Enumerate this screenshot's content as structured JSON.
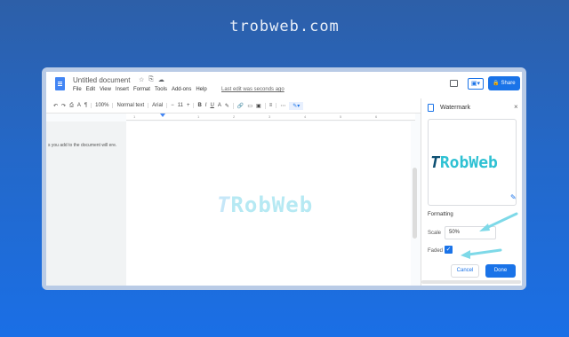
{
  "site": {
    "title": "trobweb.com"
  },
  "header": {
    "doc_title": "Untitled document",
    "title_icons": [
      "☆",
      "⎘",
      "☁"
    ],
    "menu": [
      "File",
      "Edit",
      "View",
      "Insert",
      "Format",
      "Tools",
      "Add-ons",
      "Help"
    ],
    "last_edit": "Last edit was seconds ago",
    "present_icon": "▣▾",
    "share_label": "🔒 Share"
  },
  "toolbar": {
    "undo": "↶",
    "redo": "↷",
    "print": "⎙",
    "spell": "A",
    "paint": "¶",
    "zoom": "100%",
    "style": "Normal text",
    "font": "Arial",
    "size": "11",
    "minus": "−",
    "plus": "+",
    "bold": "B",
    "italic": "I",
    "underline": "U",
    "color": "A",
    "highlight": "✎",
    "link": "🔗",
    "comment": "▭",
    "image": "▣",
    "align": "≡",
    "more": "⋯",
    "edit_mode": "✎▾"
  },
  "ruler": {
    "ticks": [
      "1",
      "1",
      "2",
      "3",
      "4",
      "5",
      "6"
    ]
  },
  "outline": {
    "text": "s you add to the document will ere."
  },
  "page": {
    "watermark_prefix": "T",
    "watermark_rest": "RobWeb"
  },
  "panel": {
    "title": "Watermark",
    "close": "×",
    "preview_prefix": "T",
    "preview_rest": "RobWeb",
    "edit_icon": "✎",
    "formatting_label": "Formatting",
    "scale_label": "Scale",
    "scale_value": "50%",
    "faded_label": "Faded",
    "faded_check": "✓",
    "cancel_label": "Cancel",
    "done_label": "Done"
  },
  "colors": {
    "accent": "#1a73e8",
    "watermark_light": "#b6e9f3",
    "arrow": "#7ed9e8"
  }
}
